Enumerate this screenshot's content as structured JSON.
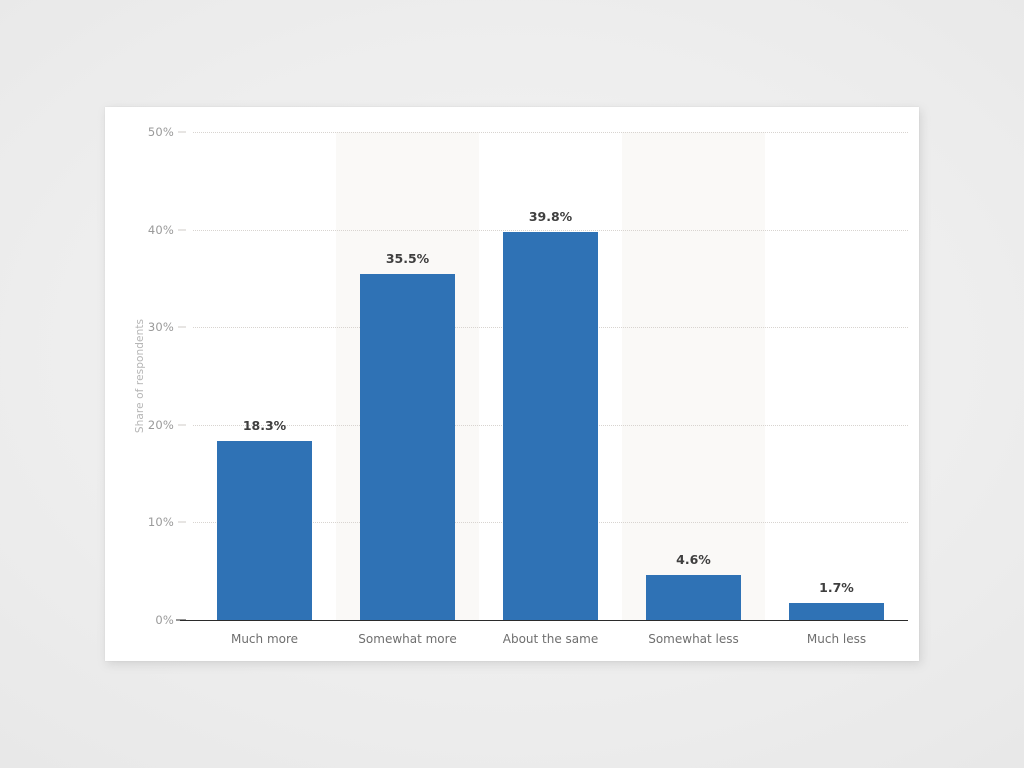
{
  "chart_data": {
    "type": "bar",
    "title": "",
    "subtitle": "",
    "xlabel": "",
    "ylabel": "Share of respondents",
    "categories": [
      "Much more",
      "Somewhat more",
      "About the same",
      "Somewhat less",
      "Much less"
    ],
    "values": [
      18.3,
      35.5,
      39.8,
      4.6,
      1.7
    ],
    "value_labels": [
      "18.3%",
      "35.5%",
      "39.8%",
      "4.6%",
      "1.7%"
    ],
    "ylim": [
      0,
      50
    ],
    "y_ticks": [
      0,
      10,
      20,
      30,
      40,
      50
    ],
    "y_tick_labels": [
      "0%",
      "10%",
      "20%",
      "30%",
      "40%",
      "50%"
    ],
    "grid": true,
    "grid_style": "dotted-horizontal",
    "legend": "none",
    "bar_color": "#2f72b5",
    "value_label_color": "#3f3f3f",
    "axis_label_color": "#6f6f6f",
    "tick_label_color": "#9a9a9a",
    "axis_title_color": "#b5b5b5",
    "band_color": "#faf9f7",
    "banded_categories": [
      "Somewhat more",
      "Somewhat less"
    ],
    "plot_background": "#ffffff",
    "page_background": "#ececec"
  }
}
